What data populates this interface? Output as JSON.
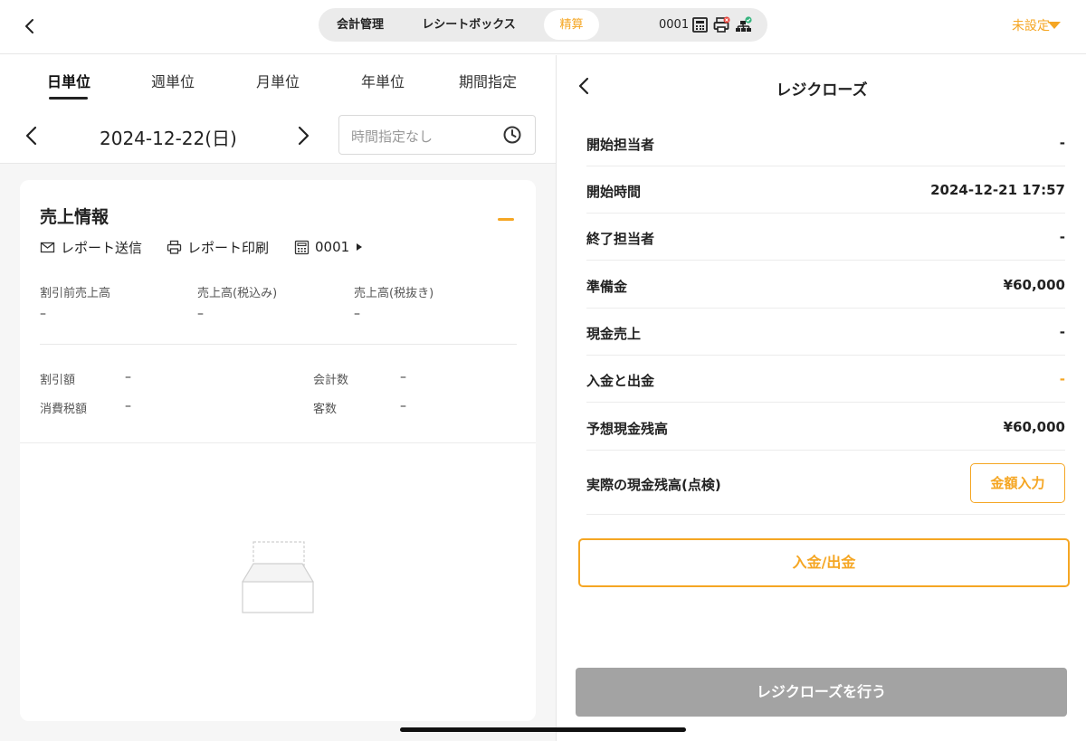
{
  "header": {
    "segments": [
      "会計管理",
      "レシートボックス",
      "精算"
    ],
    "active_segment": "精算",
    "device_id": "0001",
    "status_icons": [
      "register-icon",
      "printer-error-icon",
      "network-ok-icon"
    ],
    "store_selector": "未設定"
  },
  "left": {
    "tabs": [
      "日単位",
      "週単位",
      "月単位",
      "年単位",
      "期間指定"
    ],
    "active_tab": "日単位",
    "date": "2024-12-22(日)",
    "time_filter": {
      "placeholder": "時間指定なし"
    },
    "sales": {
      "title": "売上情報",
      "actions": {
        "send": "レポート送信",
        "print": "レポート印刷",
        "register": "0001"
      },
      "top_stats": [
        {
          "label": "割引前売上高",
          "value": "–"
        },
        {
          "label": "売上高(税込み)",
          "value": "–"
        },
        {
          "label": "売上高(税抜き)",
          "value": "–"
        }
      ],
      "bottom_stats": [
        {
          "label": "割引額",
          "value": "–"
        },
        {
          "label": "消費税額",
          "value": "–"
        },
        {
          "label": "会計数",
          "value": "–"
        },
        {
          "label": "客数",
          "value": "–"
        }
      ]
    }
  },
  "right": {
    "title": "レジクローズ",
    "rows": [
      {
        "label": "開始担当者",
        "value": "-"
      },
      {
        "label": "開始時間",
        "value": "2024-12-21 17:57"
      },
      {
        "label": "終了担当者",
        "value": "-"
      },
      {
        "label": "準備金",
        "value": "¥60,000"
      },
      {
        "label": "現金売上",
        "value": "-"
      },
      {
        "label": "入金と出金",
        "value": "-"
      },
      {
        "label": "予想現金残高",
        "value": "¥60,000"
      },
      {
        "label": "実際の現金残高(点検)",
        "button": "金額入力"
      }
    ],
    "inout_button": "入金/出金",
    "close_button": "レジクローズを行う"
  },
  "colors": {
    "accent": "#f5a623",
    "disabled": "#a3a3a3"
  }
}
